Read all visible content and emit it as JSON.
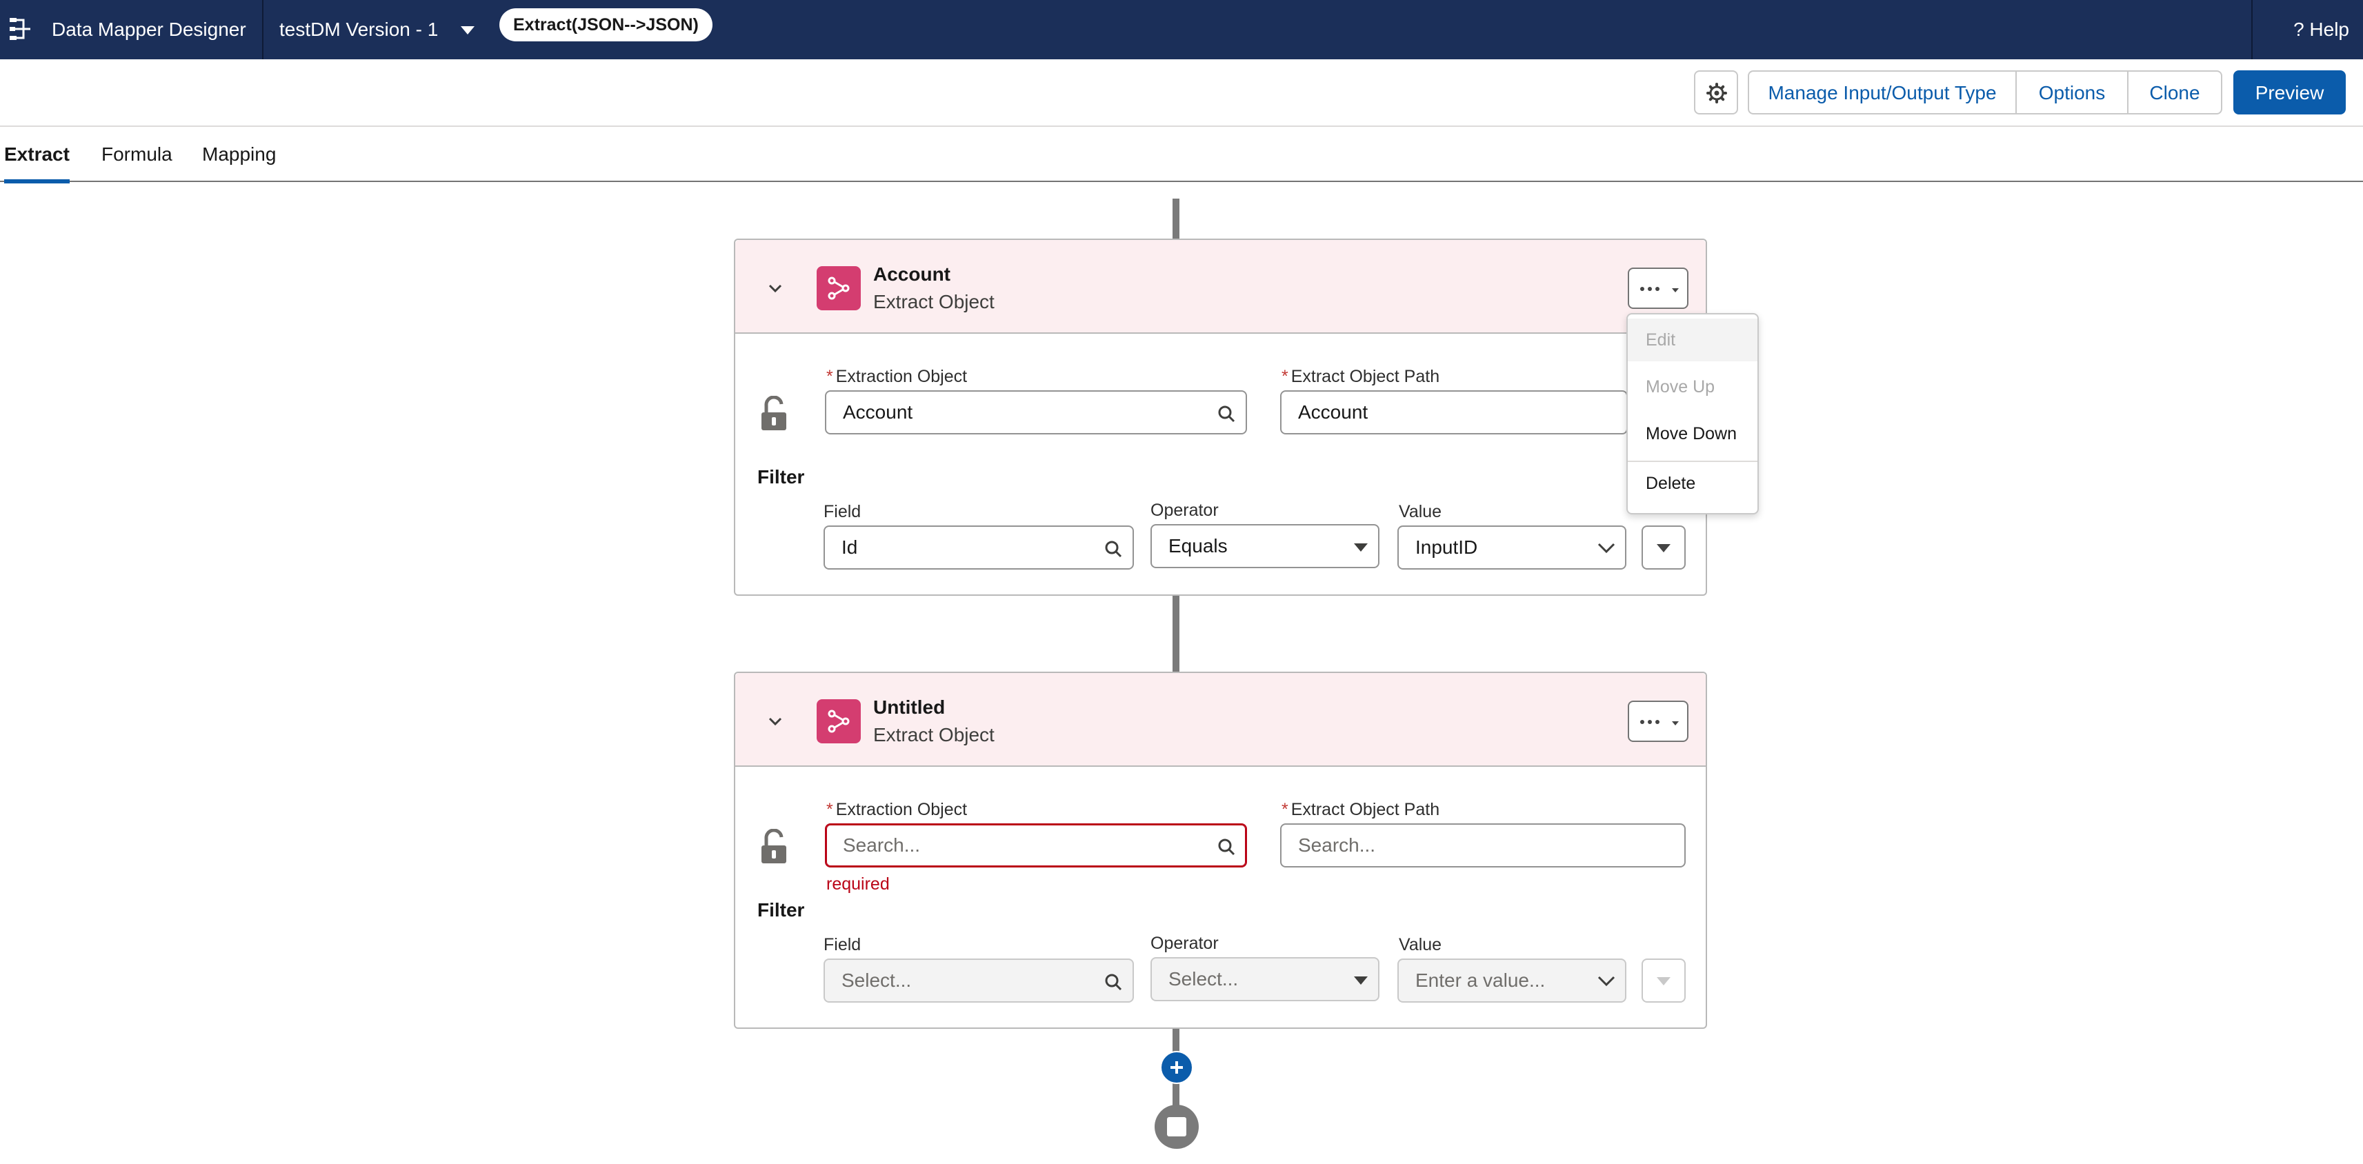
{
  "topbar": {
    "app_title": "Data Mapper Designer",
    "version_label": "testDM Version - 1",
    "type_pill": "Extract(JSON-->JSON)",
    "help_label": "? Help",
    "bg_color": "#1b2f59"
  },
  "toolbar": {
    "manage_label": "Manage Input/Output Type",
    "options_label": "Options",
    "clone_label": "Clone",
    "preview_label": "Preview"
  },
  "tabs": [
    {
      "label": "Extract",
      "active": true
    },
    {
      "label": "Formula",
      "active": false
    },
    {
      "label": "Mapping",
      "active": false
    }
  ],
  "cards": [
    {
      "title": "Account",
      "subtitle": "Extract Object",
      "extraction_object_label": "Extraction Object",
      "extraction_object_value": "Account",
      "path_label": "Extract Object Path",
      "path_value": "Account",
      "filter_title": "Filter",
      "field_label": "Field",
      "field_value": "Id",
      "operator_label": "Operator",
      "operator_value": "Equals",
      "value_label": "Value",
      "value_value": "InputID"
    },
    {
      "title": "Untitled",
      "subtitle": "Extract Object",
      "extraction_object_label": "Extraction Object",
      "extraction_object_placeholder": "Search...",
      "error_text": "required",
      "path_label": "Extract Object Path",
      "path_placeholder": "Search...",
      "filter_title": "Filter",
      "field_label": "Field",
      "field_placeholder": "Select...",
      "operator_label": "Operator",
      "operator_placeholder": "Select...",
      "value_label": "Value",
      "value_placeholder": "Enter a value..."
    }
  ],
  "menu": {
    "items": [
      {
        "label": "Edit",
        "disabled": true
      },
      {
        "label": "Move Up",
        "disabled": true
      },
      {
        "label": "Move Down",
        "disabled": false
      },
      {
        "label": "Delete",
        "disabled": false
      }
    ]
  },
  "colors": {
    "accent": "#0b5cab",
    "card_header_bg": "#fceef0",
    "object_icon": "#d43d70",
    "error": "#ba0517"
  }
}
